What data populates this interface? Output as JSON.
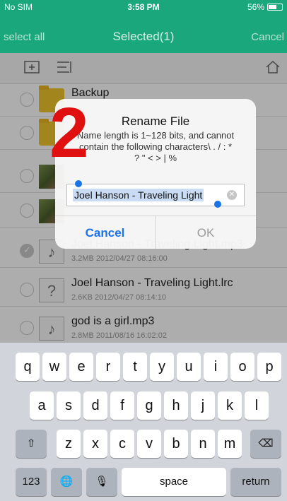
{
  "status": {
    "carrier": "No SIM",
    "time": "3:58 PM",
    "battery": "56%"
  },
  "nav": {
    "left": "select all",
    "title": "Selected(1)",
    "right": "Cancel"
  },
  "toolbar": {
    "new_folder_icon": "add-folder-icon",
    "sort_icon": "sort-list-icon",
    "home_icon": "home-icon"
  },
  "files": [
    {
      "name": "Backup",
      "meta": "",
      "thumb": "folder",
      "checked": false
    },
    {
      "name": "",
      "meta": "",
      "thumb": "folder",
      "checked": false
    },
    {
      "name": "",
      "meta": "",
      "thumb": "photo",
      "checked": false
    },
    {
      "name": "",
      "meta": "",
      "thumb": "photo",
      "checked": false
    },
    {
      "name": "Joel Hanson - Traveling Light.mp3",
      "meta": "3.2MB 2012/04/27 08:16:00",
      "thumb": "music",
      "checked": true
    },
    {
      "name": "Joel Hanson - Traveling Light.lrc",
      "meta": "2.6KB 2012/04/27 08:14:10",
      "thumb": "lrc",
      "checked": false
    },
    {
      "name": "god is a girl.mp3",
      "meta": "2.8MB 2011/08/16 16:02:02",
      "thumb": "music",
      "checked": false
    }
  ],
  "dialog": {
    "title": "Rename File",
    "message": "Name length is 1~128 bits, and cannot contain the following characters\\ . / : * ? \" < > | %",
    "input_value": "Joel Hanson - Traveling Light",
    "cancel": "Cancel",
    "ok": "OK"
  },
  "annotation": {
    "step": "2"
  },
  "keyboard": {
    "row1": [
      "q",
      "w",
      "e",
      "r",
      "t",
      "y",
      "u",
      "i",
      "o",
      "p"
    ],
    "row2": [
      "a",
      "s",
      "d",
      "f",
      "g",
      "h",
      "j",
      "k",
      "l"
    ],
    "row3": [
      "z",
      "x",
      "c",
      "v",
      "b",
      "n",
      "m"
    ],
    "shift": "⇧",
    "delete": "⌫",
    "numbers": "123",
    "globe": "🌐",
    "mic": "🎙",
    "space": "space",
    "return": "return"
  }
}
